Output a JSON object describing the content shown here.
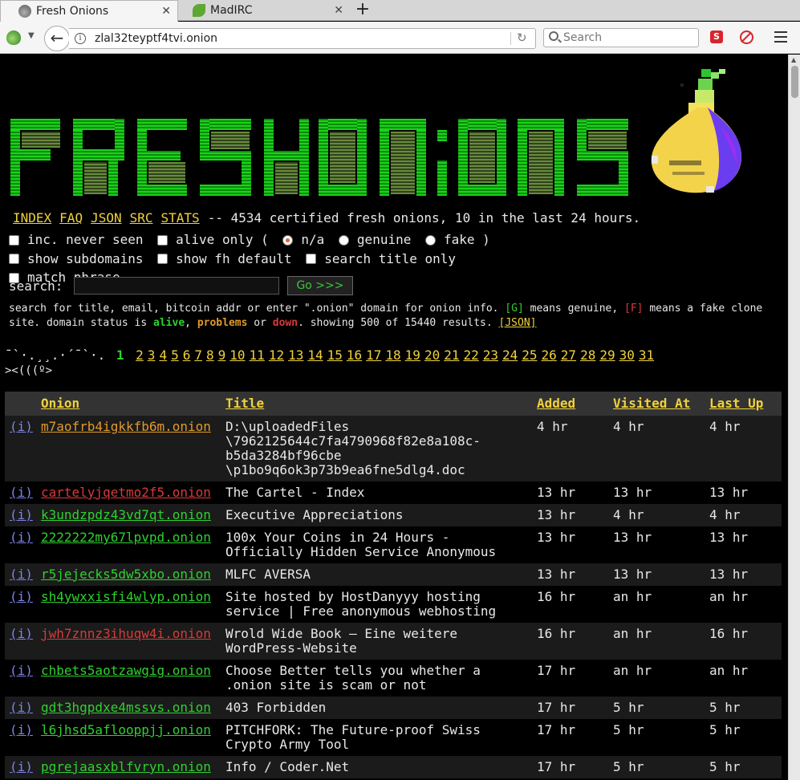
{
  "browser": {
    "tabs": [
      {
        "label": "Fresh Onions",
        "active": true
      },
      {
        "label": "MadIRC",
        "active": false
      }
    ],
    "url": "zlal32teyptf4tvi.onion",
    "search_placeholder": "Search",
    "ext_s_label": "S"
  },
  "nav": {
    "links": [
      "INDEX",
      "FAQ",
      "JSON",
      "SRC",
      "STATS"
    ],
    "stats": "-- 4534 certified fresh onions, 10 in the last 24 hours."
  },
  "options": {
    "inc_never_seen": "inc. never seen",
    "alive_only": "alive only (",
    "na": "n/a",
    "genuine": "genuine",
    "fake": "fake )",
    "show_subdomains": "show subdomains",
    "show_fh_default": "show fh default",
    "search_title_only": "search title only",
    "match_phrase": "match phrase"
  },
  "search": {
    "label": "search:",
    "button": "Go >>>"
  },
  "help": {
    "p1": "search for title, email, bitcoin addr or enter \".onion\" domain for onion info. ",
    "g_mark": "[G]",
    "p2": " means genuine, ",
    "f_mark": "[F]",
    "p3": " means a fake clone site. domain status is ",
    "alive": "alive",
    "p4": ", ",
    "problems": "problems",
    "p5": " or ",
    "down": "down",
    "p6": ". showing 500 of 15440 results. ",
    "json": "[JSON]"
  },
  "pager": {
    "prefix": "¯`·.¸¸.·´¯`·.",
    "current": "1",
    "pages": [
      "2",
      "3",
      "4",
      "5",
      "6",
      "7",
      "8",
      "9",
      "10",
      "11",
      "12",
      "13",
      "14",
      "15",
      "16",
      "17",
      "18",
      "19",
      "20",
      "21",
      "22",
      "23",
      "24",
      "25",
      "26",
      "27",
      "28",
      "29",
      "30",
      "31"
    ],
    "fish": "><(((º>"
  },
  "table": {
    "headers": [
      "Onion",
      "Title",
      "Added",
      "Visited At",
      "Last Up"
    ],
    "info_label": "(i)",
    "rows": [
      {
        "onion": "m7aofrb4igkkfb6m.onion",
        "status": "orange",
        "title": "D:\\uploadedFiles\n\\7962125644c7fa4790968f82e8a108c-\nb5da3284bf96cbe\n\\p1bo9q6ok3p73b9ea6fne5dlg4.doc",
        "added": "4 hr",
        "visited": "4 hr",
        "last": "4 hr"
      },
      {
        "onion": "cartelyjqetmo2f5.onion",
        "status": "red",
        "title": "The Cartel - Index",
        "added": "13 hr",
        "visited": "13 hr",
        "last": "13 hr"
      },
      {
        "onion": "k3undzpdz43vd7qt.onion",
        "status": "green",
        "title": "Executive Appreciations",
        "added": "13 hr",
        "visited": "4 hr",
        "last": "4 hr"
      },
      {
        "onion": "2222222my67lpvpd.onion",
        "status": "green",
        "title": "100x Your Coins in 24 Hours -\nOfficially Hidden Service Anonymous",
        "added": "13 hr",
        "visited": "13 hr",
        "last": "13 hr"
      },
      {
        "onion": "r5jejecks5dw5xbo.onion",
        "status": "green",
        "title": "MLFC AVERSA",
        "added": "13 hr",
        "visited": "13 hr",
        "last": "13 hr"
      },
      {
        "onion": "sh4ywxxisfi4wlyp.onion",
        "status": "green",
        "title": "Site hosted by HostDanyyy hosting\nservice | Free anonymous webhosting",
        "added": "16 hr",
        "visited": "an hr",
        "last": "an hr"
      },
      {
        "onion": "jwh7znnz3ihuqw4i.onion",
        "status": "red",
        "title": "Wrold Wide Book – Eine weitere\nWordPress-Website",
        "added": "16 hr",
        "visited": "an hr",
        "last": "16 hr"
      },
      {
        "onion": "chbets5aotzawgig.onion",
        "status": "green",
        "title": "Choose Better tells you whether a\n.onion site is scam or not",
        "added": "17 hr",
        "visited": "an hr",
        "last": "an hr"
      },
      {
        "onion": "gdt3hgpdxe4mssvs.onion",
        "status": "green",
        "title": "403 Forbidden",
        "added": "17 hr",
        "visited": "5 hr",
        "last": "5 hr"
      },
      {
        "onion": "l6jhsd5aflooppjj.onion",
        "status": "green",
        "title": "PITCHFORK: The Future-proof Swiss\nCrypto Army Tool",
        "added": "17 hr",
        "visited": "5 hr",
        "last": "5 hr"
      },
      {
        "onion": "pgrejaasxblfvryn.onion",
        "status": "green",
        "title": "Info / Coder.Net",
        "added": "17 hr",
        "visited": "5 hr",
        "last": "5 hr"
      }
    ]
  }
}
